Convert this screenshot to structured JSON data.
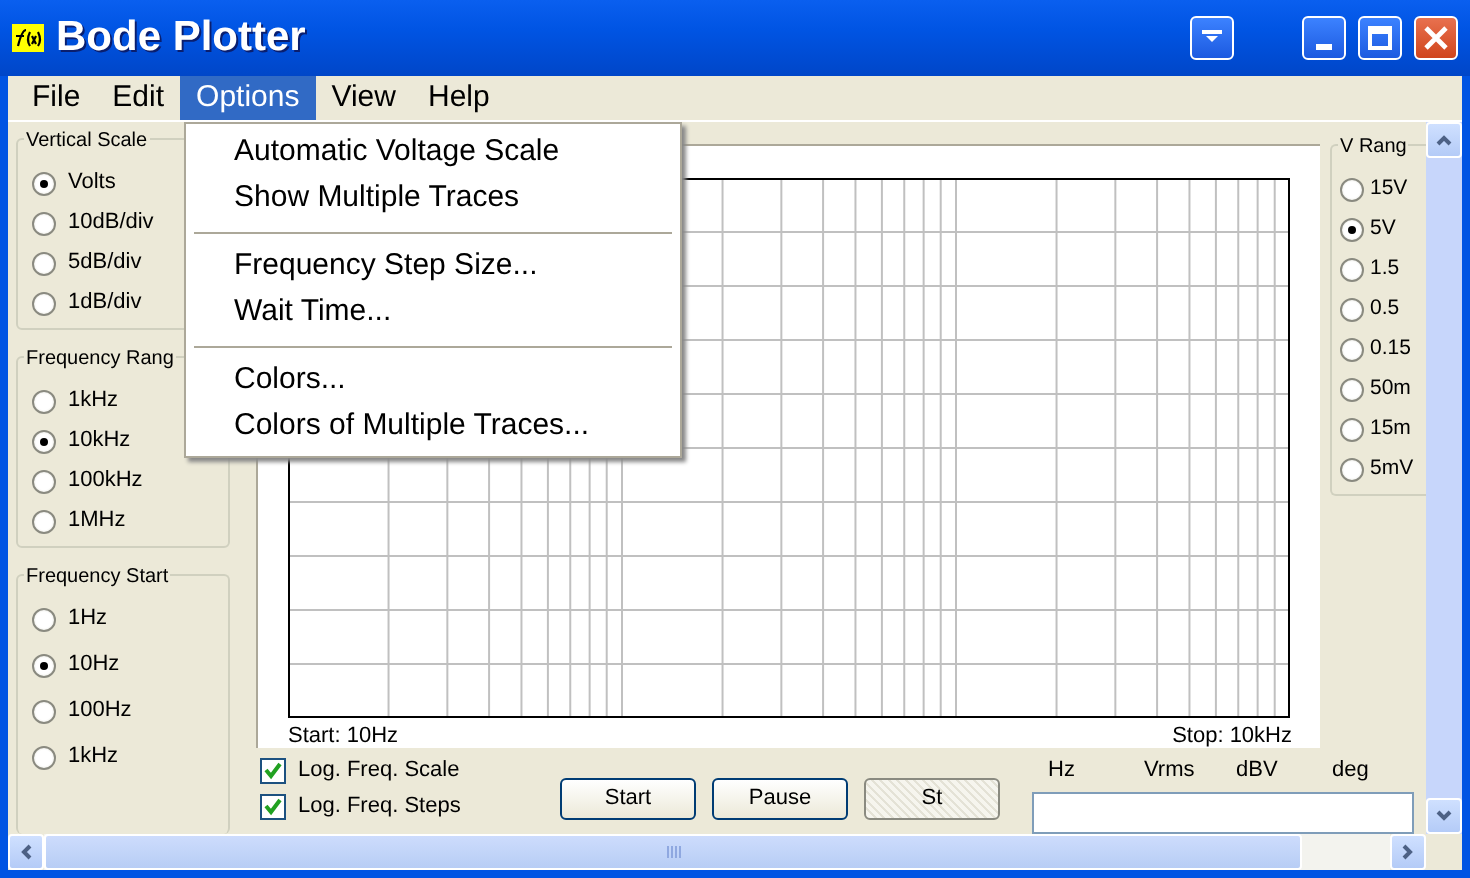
{
  "window": {
    "title": "Bode Plotter"
  },
  "menu": [
    {
      "label": "File",
      "selected": false
    },
    {
      "label": "Edit",
      "selected": false
    },
    {
      "label": "Options",
      "selected": true
    },
    {
      "label": "View",
      "selected": false
    },
    {
      "label": "Help",
      "selected": false
    }
  ],
  "options_menu": [
    {
      "kind": "item",
      "label": "Automatic Voltage Scale"
    },
    {
      "kind": "item",
      "label": "Show Multiple Traces"
    },
    {
      "kind": "separator"
    },
    {
      "kind": "item",
      "label": "Frequency Step Size..."
    },
    {
      "kind": "item",
      "label": "Wait Time..."
    },
    {
      "kind": "separator"
    },
    {
      "kind": "item",
      "label": "Colors..."
    },
    {
      "kind": "item",
      "label": "Colors of Multiple Traces..."
    }
  ],
  "left_groups": [
    {
      "title": "Vertical Scale",
      "options": [
        {
          "label": "Volts",
          "selected": true
        },
        {
          "label": "10dB/div",
          "selected": false
        },
        {
          "label": "5dB/div",
          "selected": false
        },
        {
          "label": "1dB/div",
          "selected": false
        }
      ]
    },
    {
      "title": "Frequency Rang",
      "options": [
        {
          "label": "1kHz",
          "selected": false
        },
        {
          "label": "10kHz",
          "selected": true
        },
        {
          "label": "100kHz",
          "selected": false
        },
        {
          "label": "1MHz",
          "selected": false
        }
      ]
    },
    {
      "title": "Frequency Start",
      "options": [
        {
          "label": "1Hz",
          "selected": false
        },
        {
          "label": "10Hz",
          "selected": true
        },
        {
          "label": "100Hz",
          "selected": false
        },
        {
          "label": "1kHz",
          "selected": false
        }
      ]
    }
  ],
  "v_range": {
    "title": "V Rang",
    "options": [
      {
        "label": "15V",
        "selected": false
      },
      {
        "label": "5V",
        "selected": true
      },
      {
        "label": "1.5",
        "selected": false
      },
      {
        "label": "0.5",
        "selected": false
      },
      {
        "label": "0.15",
        "selected": false
      },
      {
        "label": "50m",
        "selected": false
      },
      {
        "label": "15m",
        "selected": false
      },
      {
        "label": "5mV",
        "selected": false
      }
    ]
  },
  "plot": {
    "start_label": "Start: 10Hz",
    "stop_label": "Stop: 10kHz"
  },
  "checkboxes": [
    {
      "label": "Log. Freq. Scale",
      "checked": true
    },
    {
      "label": "Log. Freq. Steps",
      "checked": true
    }
  ],
  "buttons": [
    {
      "label": "Start",
      "pressed": false
    },
    {
      "label": "Pause",
      "pressed": false
    },
    {
      "label": "St",
      "pressed": true
    }
  ],
  "readout": {
    "columns": [
      "Hz",
      "Vrms",
      "dBV",
      "deg"
    ]
  }
}
